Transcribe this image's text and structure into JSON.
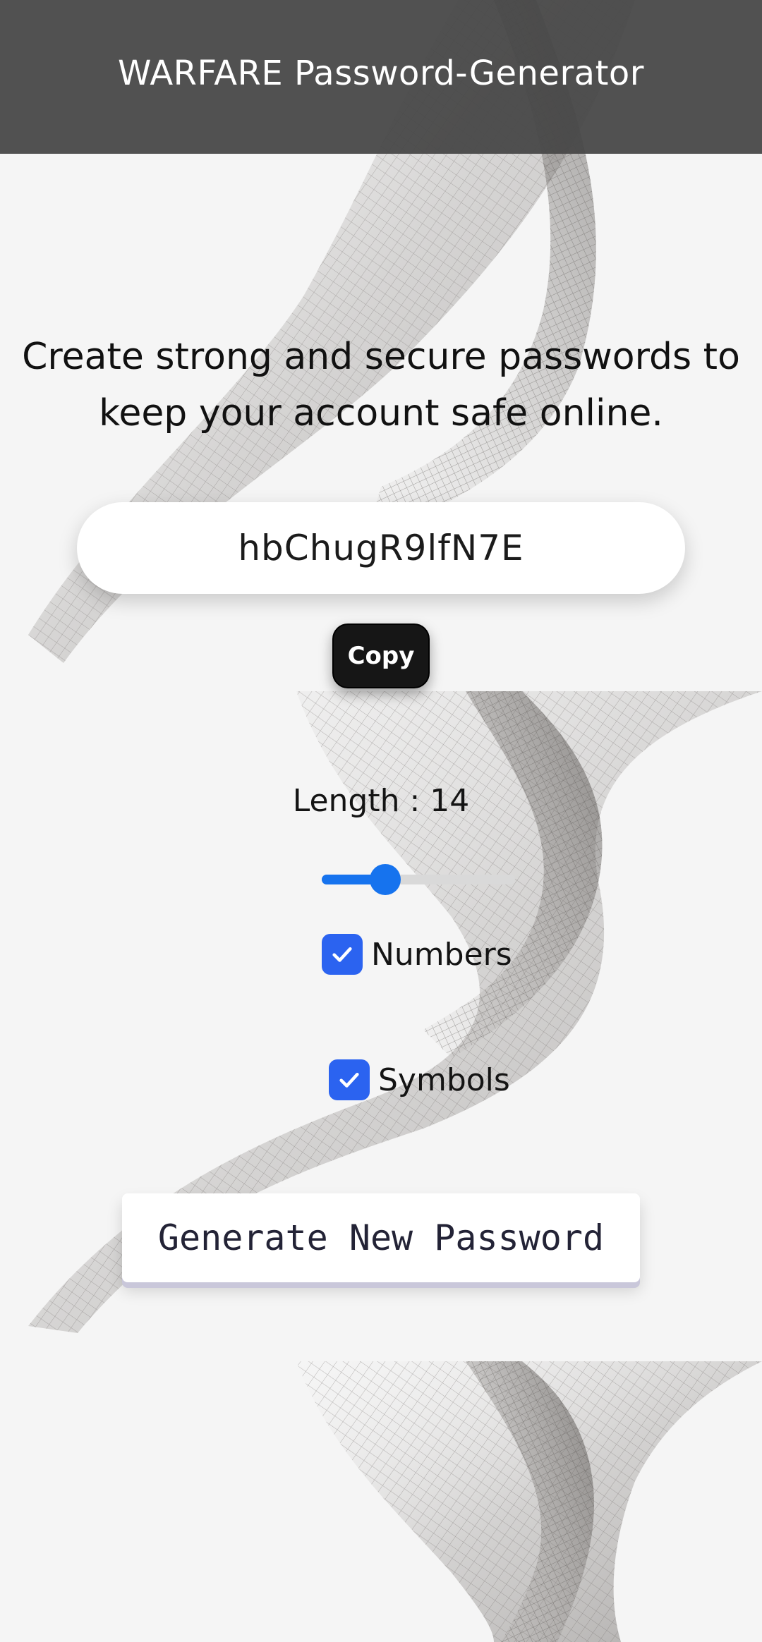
{
  "header": {
    "title": "WARFARE Password-Generator"
  },
  "main": {
    "tagline": "Create strong and secure passwords to keep your account safe online.",
    "password": "hbChugR9lfN7E",
    "copy_label": "Copy",
    "length_text": "Length : 14",
    "length_slider_fraction": 0.33,
    "options": {
      "numbers": {
        "label": "Numbers",
        "checked": true
      },
      "symbols": {
        "label": "Symbols",
        "checked": true
      }
    },
    "generate_label": "Generate New Password"
  },
  "colors": {
    "header_bg": "#484848",
    "accent_blue": "#1673ee",
    "checkbox_blue": "#2b63f0",
    "copy_button_bg": "#161616",
    "page_bg": "#f5f5f5"
  },
  "icons": {
    "checkbox_mark": "check-icon",
    "background": "wave-mesh-art"
  }
}
